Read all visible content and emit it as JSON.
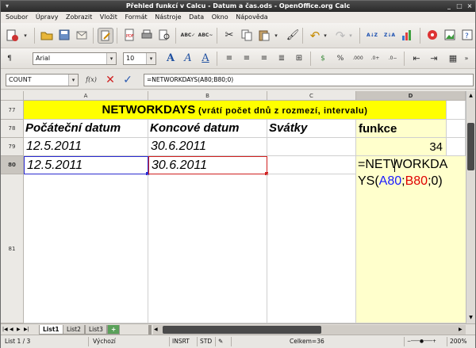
{
  "window": {
    "title": "Přehled funkcí v Calcu - Datum a čas.ods - OpenOffice.org Calc"
  },
  "menu": [
    "Soubor",
    "Úpravy",
    "Zobrazit",
    "Vložit",
    "Formát",
    "Nástroje",
    "Data",
    "Okno",
    "Nápověda"
  ],
  "format_toolbar": {
    "font_name": "Arial",
    "font_size": "10"
  },
  "formula_bar": {
    "name_box": "COUNT",
    "fx_label": "f(x)",
    "content": "=NETWORKDAYS(A80;B80;0)"
  },
  "columns": [
    "A",
    "B",
    "C",
    "D"
  ],
  "rows": {
    "r77": {
      "num": "77",
      "title": "NETWORKDAYS",
      "subtitle": " (vrátí počet dnů z rozmezí, intervalu)"
    },
    "r78": {
      "num": "78",
      "a": "Počáteční datum",
      "b": "Koncové datum",
      "c": "Svátky",
      "d": "funkce"
    },
    "r79": {
      "num": "79",
      "a": "12.5.2011",
      "b": "30.6.2011",
      "c": "",
      "d": "34"
    },
    "r80": {
      "num": "80",
      "a": "12.5.2011",
      "b": "30.6.2011",
      "c": "",
      "d_line1": "=NETWORKDA",
      "d_ys": "YS(",
      "d_ref1": "A80",
      "d_semi1": ";",
      "d_ref2": "B80",
      "d_semi2": ";",
      "d_tail": "0)"
    },
    "r81": {
      "num": "81"
    }
  },
  "sheet_tabs": [
    "List1",
    "List2",
    "List3"
  ],
  "status": {
    "sheet": "List 1 / 3",
    "style": "Výchozí",
    "mode": "INSRT",
    "sel": "STD",
    "sum": "Celkem=36",
    "zoom": "200%"
  },
  "colors": {
    "title_bg": "#ffff00",
    "formula_col_bg": "#ffffcc",
    "ref1": "#1a1aff",
    "ref2": "#e00000"
  }
}
